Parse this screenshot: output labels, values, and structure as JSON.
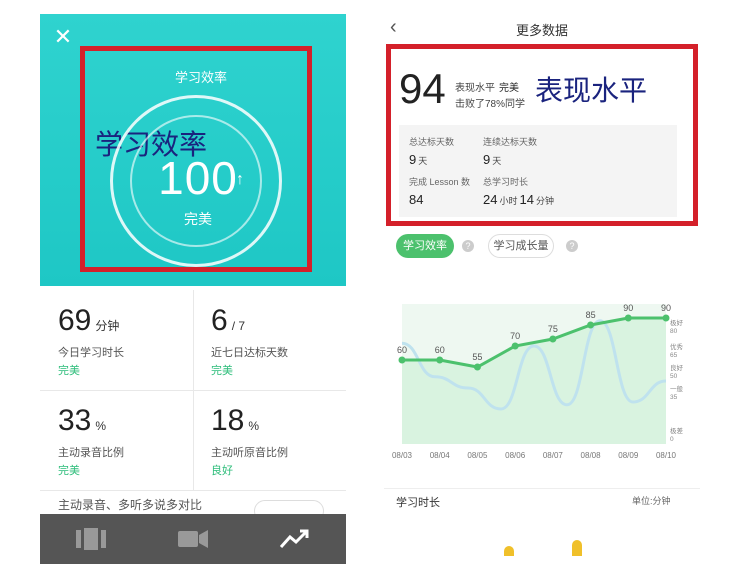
{
  "left": {
    "close_icon": "close-icon",
    "hero_title": "学习效率",
    "hero_overlay": "学习效率",
    "score": "100",
    "score_arrow": "↑",
    "score_label": "完美",
    "stats": [
      {
        "value": "69",
        "unit": "分钟",
        "label": "今日学习时长",
        "rating": "完美"
      },
      {
        "value": "6",
        "unit": "/ 7",
        "label": "近七日达标天数",
        "rating": "完美"
      },
      {
        "value": "33",
        "unit": "%",
        "label": "主动录音比例",
        "rating": "完美"
      },
      {
        "value": "18",
        "unit": "%",
        "label": "主动听原音比例",
        "rating": "良好"
      }
    ],
    "cut_row": "主动录音、多听多说多对比",
    "tabs": [
      "video-strip-icon",
      "camera-icon",
      "trend-icon"
    ]
  },
  "right": {
    "back_icon": "chevron-left-icon",
    "nav_title": "更多数据",
    "big_score": "94",
    "level_label": "表现水平",
    "level_value": "完美",
    "beat_text": "击败了78%同学",
    "summary_overlay": "表现水平",
    "summary_stats": [
      {
        "label": "总达标天数",
        "value": "9",
        "unit": "天"
      },
      {
        "label": "连续达标天数",
        "value": "9",
        "unit": "天"
      },
      {
        "label": "完成 Lesson 数",
        "value": "84",
        "unit": ""
      },
      {
        "label": "总学习时长",
        "value": "24",
        "unit": "小时",
        "value2": "14",
        "unit2": "分钟"
      }
    ],
    "chip_efficiency": "学习效率",
    "chip_growth": "学习成长量",
    "help_mark": "?",
    "study_time_label": "学习时长",
    "unit_label": "单位:分钟"
  },
  "chart_data": {
    "type": "line",
    "categories": [
      "08/03",
      "08/04",
      "08/05",
      "08/06",
      "08/07",
      "08/08",
      "08/09",
      "08/10"
    ],
    "series": [
      {
        "values": [
          60,
          60,
          55,
          70,
          75,
          85,
          90,
          90
        ],
        "color": "#4cc16d"
      }
    ],
    "y_band_labels": [
      "极好\n80",
      "优秀\n65",
      "良好\n50",
      "一般\n35",
      "极差\n0"
    ],
    "colors": {
      "line": "#4cc16d",
      "fill": "#d9f3e0",
      "wave": "#bfe2ee"
    }
  }
}
